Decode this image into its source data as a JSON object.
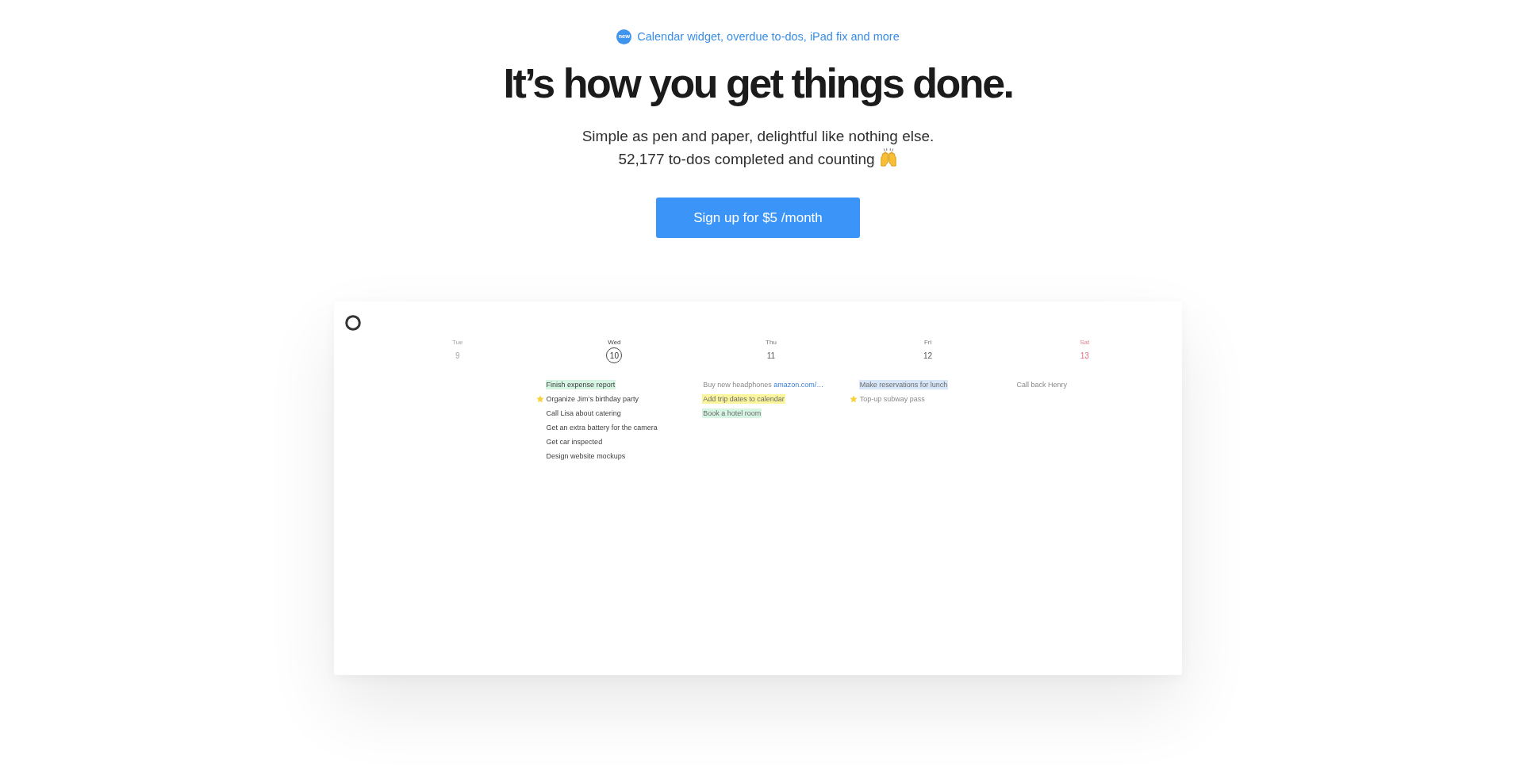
{
  "announcement": {
    "badge": "new",
    "text": "Calendar widget, overdue to-dos, iPad fix and more"
  },
  "headline": "It’s how you get things done.",
  "subtitle": [
    "Simple as pen and paper, delightful like nothing else.",
    "52,177 to-dos completed and counting"
  ],
  "cta_button": {
    "label": "Sign up for $5 /month"
  },
  "calendar": {
    "days": [
      {
        "name": "Tue",
        "date": "9",
        "past": true,
        "today": false,
        "weekend": false
      },
      {
        "name": "Wed",
        "date": "10",
        "past": false,
        "today": true,
        "weekend": false,
        "todos": [
          {
            "text": "Finish expense report",
            "starred": false,
            "color": "#d6f5e3"
          },
          {
            "text": "Organize Jim’s birthday party",
            "starred": true
          },
          {
            "text": "Call Lisa about catering",
            "starred": false
          },
          {
            "text": "Get an extra battery for the camera",
            "starred": false
          },
          {
            "text": "Get car inspected",
            "starred": false
          },
          {
            "text": "Design website mockups",
            "starred": false
          }
        ]
      },
      {
        "name": "Thu",
        "date": "11",
        "past": false,
        "today": false,
        "weekend": false,
        "todos": [
          {
            "text": "Buy new headphones",
            "link": "amazon.com/…",
            "starred": false
          },
          {
            "text": "Add trip dates to calendar",
            "starred": false,
            "color": "#fbf59e"
          },
          {
            "text": "Book a hotel room",
            "starred": false,
            "color": "#d6f5e3"
          }
        ]
      },
      {
        "name": "Fri",
        "date": "12",
        "past": false,
        "today": false,
        "weekend": false,
        "todos": [
          {
            "text": "Make reservations for lunch",
            "starred": false,
            "color": "#d8e6f9"
          },
          {
            "text": "Top-up subway pass",
            "starred": true
          }
        ]
      },
      {
        "name": "Sat",
        "date": "13",
        "past": false,
        "today": false,
        "weekend": true,
        "todos": [
          {
            "text": "Call back Henry",
            "starred": false
          }
        ]
      }
    ]
  }
}
